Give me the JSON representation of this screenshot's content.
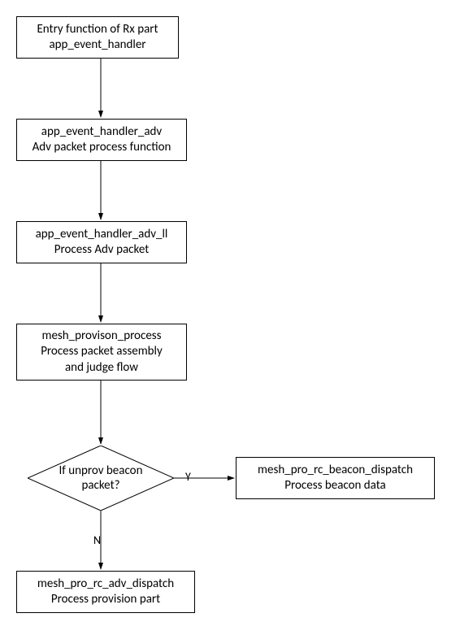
{
  "nodes": {
    "n1": {
      "line1": "Entry function of Rx part",
      "line2": "app_event_handler"
    },
    "n2": {
      "line1": "app_event_handler_adv",
      "line2": "Adv packet process function"
    },
    "n3": {
      "line1": "app_event_handler_adv_ll",
      "line2": "Process Adv packet"
    },
    "n4": {
      "line1": "mesh_provison_process",
      "line2": "Process packet assembly",
      "line3": "and judge flow"
    },
    "d1": {
      "line1": "If unprov beacon",
      "line2": "packet?"
    },
    "n5": {
      "line1": "mesh_pro_rc_beacon_dispatch",
      "line2": "Process beacon data"
    },
    "n6": {
      "line1": "mesh_pro_rc_adv_dispatch",
      "line2": "Process provision part"
    }
  },
  "labels": {
    "yes": "Y",
    "no": "N"
  },
  "chart_data": {
    "type": "flowchart",
    "nodes": [
      {
        "id": "n1",
        "kind": "process",
        "text": "Entry function of Rx part\napp_event_handler"
      },
      {
        "id": "n2",
        "kind": "process",
        "text": "app_event_handler_adv\nAdv packet process function"
      },
      {
        "id": "n3",
        "kind": "process",
        "text": "app_event_handler_adv_ll\nProcess Adv packet"
      },
      {
        "id": "n4",
        "kind": "process",
        "text": "mesh_provison_process\nProcess packet assembly\nand judge flow"
      },
      {
        "id": "d1",
        "kind": "decision",
        "text": "If unprov beacon packet?"
      },
      {
        "id": "n5",
        "kind": "process",
        "text": "mesh_pro_rc_beacon_dispatch\nProcess beacon data"
      },
      {
        "id": "n6",
        "kind": "process",
        "text": "mesh_pro_rc_adv_dispatch\nProcess provision part"
      }
    ],
    "edges": [
      {
        "from": "n1",
        "to": "n2"
      },
      {
        "from": "n2",
        "to": "n3"
      },
      {
        "from": "n3",
        "to": "n4"
      },
      {
        "from": "n4",
        "to": "d1"
      },
      {
        "from": "d1",
        "to": "n5",
        "label": "Y"
      },
      {
        "from": "d1",
        "to": "n6",
        "label": "N"
      }
    ]
  }
}
